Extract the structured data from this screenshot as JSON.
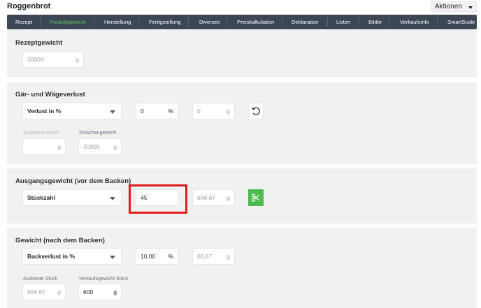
{
  "app": {
    "title": "Roggenbrot",
    "actions_label": "Aktionen"
  },
  "tabs": [
    {
      "label": "Rezept"
    },
    {
      "label": "Produktgewicht"
    },
    {
      "label": "Herstellung"
    },
    {
      "label": "Fertigstellung"
    },
    {
      "label": "Diverses"
    },
    {
      "label": "Preiskalkulation"
    },
    {
      "label": "Deklaration"
    },
    {
      "label": "Listen"
    },
    {
      "label": "Bilder"
    },
    {
      "label": "Verkaufsinfo"
    },
    {
      "label": "SmartScale"
    }
  ],
  "active_tab": "Produktgewicht",
  "rezeptgewicht": {
    "title": "Rezeptgewicht",
    "value": "30000",
    "unit": "g"
  },
  "verlust": {
    "title": "Gär- und Wägeverlust",
    "select_value": "Verlust in %",
    "percent_value": "0",
    "percent_unit": "%",
    "gram_value": "0",
    "gram_unit": "g",
    "ausgleich_label": "Ausgleichverlust",
    "ausgleich_unit": "g",
    "zwischen_label": "Zwischengewicht",
    "zwischen_value": "30000",
    "zwischen_unit": "g"
  },
  "ausgang": {
    "title": "Ausgangsgewicht (vor dem Backen)",
    "select_value": "Stückzahl",
    "count_value": "45",
    "gram_value": "666,67",
    "gram_unit": "g"
  },
  "gewicht": {
    "title": "Gewicht (nach dem Backen)",
    "select_value": "Backverlust in %",
    "percent_value": "10,00",
    "percent_unit": "%",
    "gram_value": "66,67",
    "gram_unit": "g",
    "ausbeute_label": "Ausbeute Stück",
    "ausbeute_value": "666,67",
    "ausbeute_unit": "g",
    "verkauf_label": "Verkaufsgewicht Stück",
    "verkauf_value": "600",
    "verkauf_unit": "g"
  },
  "icons": {
    "reset": "rotate-ccw-icon",
    "split": "scissors-icon"
  },
  "colors": {
    "accent_green": "#4cba4e",
    "tabbar": "#3b4755",
    "highlight_red": "#e21b1b"
  }
}
